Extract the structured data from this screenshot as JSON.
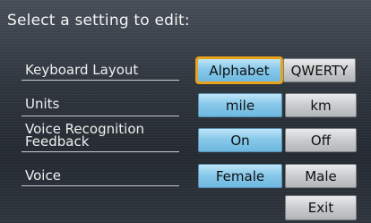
{
  "title": "Select a setting to edit:",
  "rows": [
    {
      "label": "Keyboard Layout",
      "options": [
        "Alphabet",
        "QWERTY"
      ],
      "selected": "Alphabet"
    },
    {
      "label": "Units",
      "options": [
        "mile",
        "km"
      ],
      "selected": "mile"
    },
    {
      "label": "Voice Recognition Feedback",
      "label_lines": [
        "Voice Recognition",
        "Feedback"
      ],
      "options": [
        "On",
        "Off"
      ],
      "selected": "On"
    },
    {
      "label": "Voice",
      "options": [
        "Female",
        "Male"
      ],
      "selected": "Female"
    }
  ],
  "exit_label": "Exit",
  "colors": {
    "selected": "#88c9ea",
    "unselected": "#c9cbcd",
    "focus": "#e8a31a"
  }
}
